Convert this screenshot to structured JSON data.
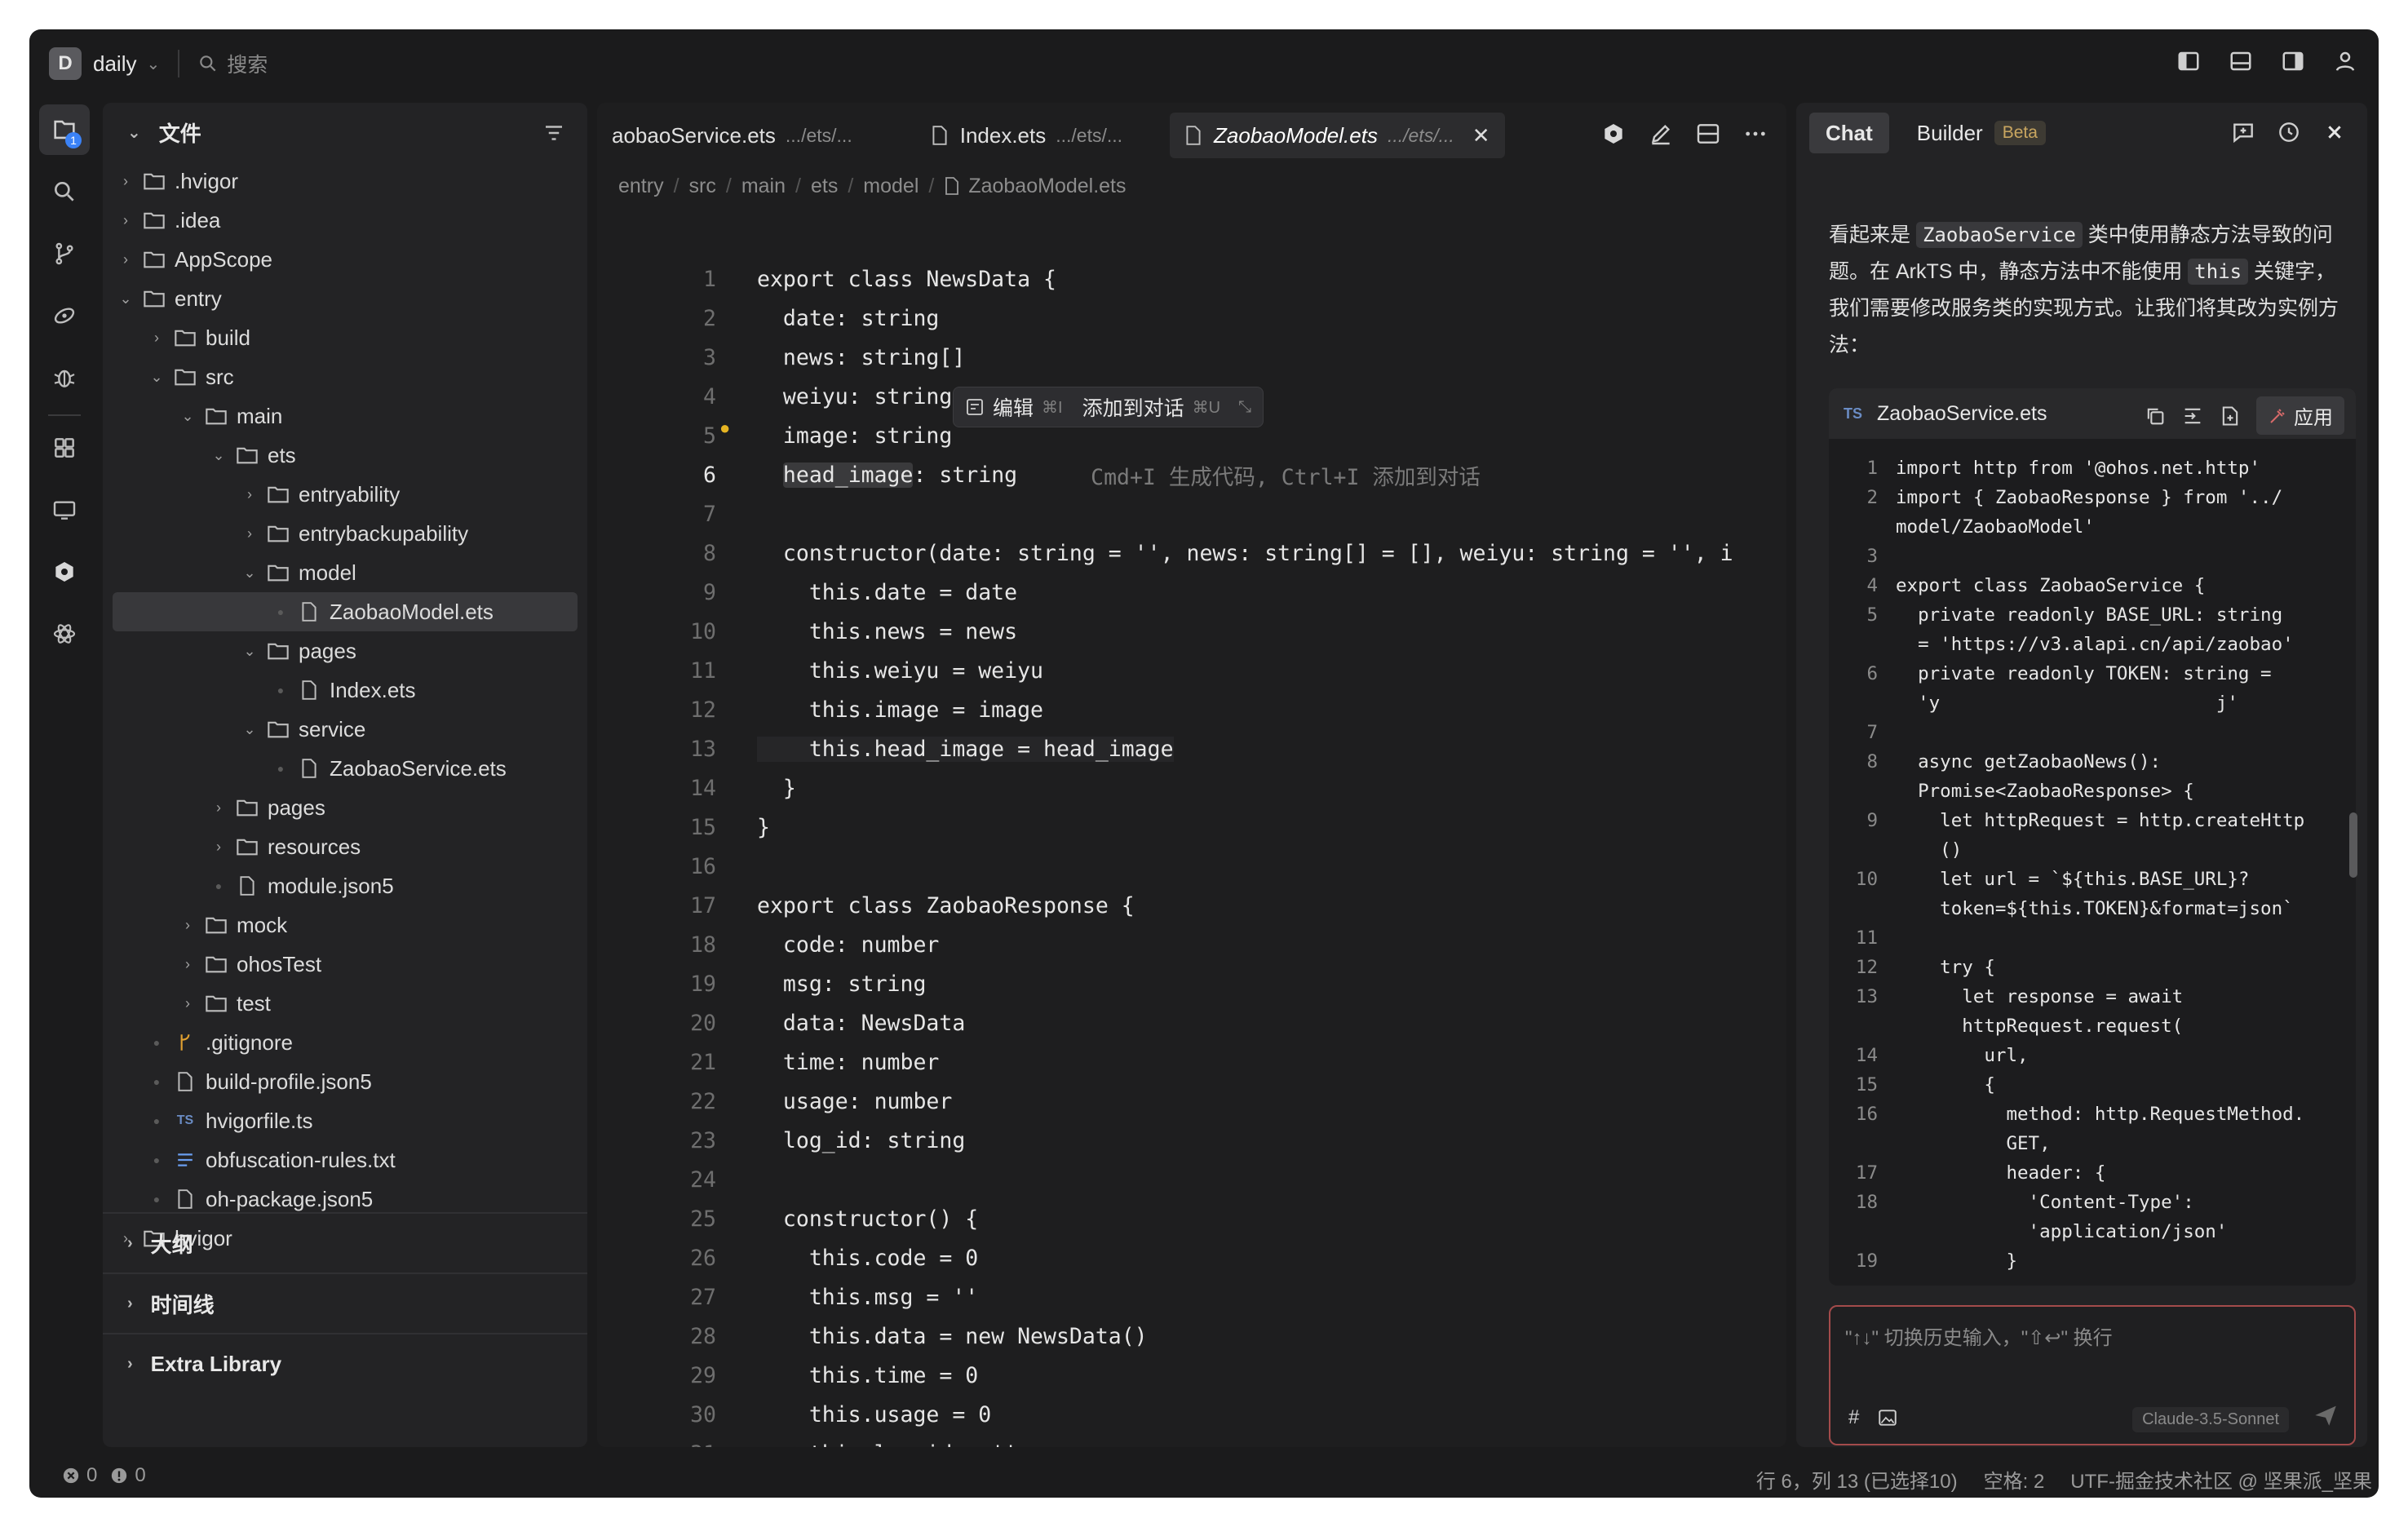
{
  "titlebar": {
    "workspace_initial": "D",
    "workspace_name": "daily",
    "search_placeholder": "搜索"
  },
  "activity": {
    "explorer_badge": "1"
  },
  "explorer": {
    "title": "文件",
    "tree": [
      {
        "label": ".hvigor",
        "kind": "folder",
        "depth": 0,
        "state": "collapsed"
      },
      {
        "label": ".idea",
        "kind": "folder",
        "depth": 0,
        "state": "collapsed"
      },
      {
        "label": "AppScope",
        "kind": "folder",
        "depth": 0,
        "state": "collapsed"
      },
      {
        "label": "entry",
        "kind": "folder",
        "depth": 0,
        "state": "expanded"
      },
      {
        "label": "build",
        "kind": "folder",
        "depth": 1,
        "state": "collapsed"
      },
      {
        "label": "src",
        "kind": "folder",
        "depth": 1,
        "state": "expanded"
      },
      {
        "label": "main",
        "kind": "folder",
        "depth": 2,
        "state": "expanded"
      },
      {
        "label": "ets",
        "kind": "folder",
        "depth": 3,
        "state": "expanded"
      },
      {
        "label": "entryability",
        "kind": "folder",
        "depth": 4,
        "state": "collapsed"
      },
      {
        "label": "entrybackupability",
        "kind": "folder",
        "depth": 4,
        "state": "collapsed"
      },
      {
        "label": "model",
        "kind": "folder",
        "depth": 4,
        "state": "expanded"
      },
      {
        "label": "ZaobaoModel.ets",
        "kind": "file",
        "depth": 5,
        "state": "selected"
      },
      {
        "label": "pages",
        "kind": "folder",
        "depth": 4,
        "state": "expanded"
      },
      {
        "label": "Index.ets",
        "kind": "file",
        "depth": 5,
        "state": "file"
      },
      {
        "label": "service",
        "kind": "folder",
        "depth": 4,
        "state": "expanded"
      },
      {
        "label": "ZaobaoService.ets",
        "kind": "file",
        "depth": 5,
        "state": "file"
      },
      {
        "label": "pages",
        "kind": "folder",
        "depth": 3,
        "state": "collapsed"
      },
      {
        "label": "resources",
        "kind": "folder",
        "depth": 3,
        "state": "collapsed"
      },
      {
        "label": "module.json5",
        "kind": "file",
        "depth": 3,
        "state": "file"
      },
      {
        "label": "mock",
        "kind": "folder",
        "depth": 2,
        "state": "collapsed"
      },
      {
        "label": "ohosTest",
        "kind": "folder",
        "depth": 2,
        "state": "collapsed"
      },
      {
        "label": "test",
        "kind": "folder",
        "depth": 2,
        "state": "collapsed"
      },
      {
        "label": ".gitignore",
        "kind": "git",
        "depth": 1,
        "state": "file"
      },
      {
        "label": "build-profile.json5",
        "kind": "file",
        "depth": 1,
        "state": "file"
      },
      {
        "label": "hvigorfile.ts",
        "kind": "ts",
        "depth": 1,
        "state": "file"
      },
      {
        "label": "obfuscation-rules.txt",
        "kind": "txt",
        "depth": 1,
        "state": "file"
      },
      {
        "label": "oh-package.json5",
        "kind": "file",
        "depth": 1,
        "state": "file"
      },
      {
        "label": "hvigor",
        "kind": "folder",
        "depth": 0,
        "state": "collapsed"
      }
    ],
    "sections": [
      "大纲",
      "时间线",
      "Extra Library"
    ]
  },
  "editor": {
    "tabs": [
      {
        "name": "aobaoService.ets",
        "path": ".../ets/...",
        "active": false
      },
      {
        "name": "Index.ets",
        "path": ".../ets/...",
        "active": false
      },
      {
        "name": "ZaobaoModel.ets",
        "path": ".../ets/...",
        "active": true
      }
    ],
    "breadcrumb": [
      "entry",
      "src",
      "main",
      "ets",
      "model",
      "ZaobaoModel.ets"
    ],
    "inline_popup": {
      "edit": "编辑",
      "edit_key": "⌘I",
      "add": "添加到对话",
      "add_key": "⌘U"
    },
    "ghost_hint": "Cmd+I 生成代码, Ctrl+I 添加到对话",
    "current_line": "6",
    "lines": [
      "export class NewsData {",
      "  date: string",
      "  news: string[]",
      "  weiyu: string",
      "  image: string",
      "  head_image: string",
      "",
      "  constructor(date: string = '', news: string[] = [], weiyu: string = '', i",
      "    this.date = date",
      "    this.news = news",
      "    this.weiyu = weiyu",
      "    this.image = image",
      "    this.head_image = head_image",
      "  }",
      "}",
      "",
      "export class ZaobaoResponse {",
      "  code: number",
      "  msg: string",
      "  data: NewsData",
      "  time: number",
      "  usage: number",
      "  log_id: string",
      "",
      "  constructor() {",
      "    this.code = 0",
      "    this.msg = ''",
      "    this.data = new NewsData()",
      "    this.time = 0",
      "    this.usage = 0",
      "    this.log_id = ''"
    ]
  },
  "chat": {
    "tab_chat": "Chat",
    "tab_builder": "Builder",
    "beta": "Beta",
    "message_parts": [
      "看起来是 ",
      "ZaobaoService",
      " 类中使用静态方法导致的问题。在 ArkTS 中，静态方法中不能使用 ",
      "this",
      " 关键字，我们需要修改服务类的实现方式。让我们将其改为实例方法："
    ],
    "code_file": "ZaobaoService.ets",
    "code_lang": "TS",
    "apply_label": "应用",
    "code_lines": [
      {
        "n": "1",
        "t": "import http from '@ohos.net.http'"
      },
      {
        "n": "2",
        "t": "import { ZaobaoResponse } from '../"
      },
      {
        "n": "",
        "t": "model/ZaobaoModel'"
      },
      {
        "n": "3",
        "t": ""
      },
      {
        "n": "4",
        "t": "export class ZaobaoService {"
      },
      {
        "n": "5",
        "t": "  private readonly BASE_URL: string"
      },
      {
        "n": "",
        "t": "  = 'https://v3.alapi.cn/api/zaobao'"
      },
      {
        "n": "6",
        "t": "  private readonly TOKEN: string ="
      },
      {
        "n": "",
        "t": "  'y                         j'"
      },
      {
        "n": "7",
        "t": ""
      },
      {
        "n": "8",
        "t": "  async getZaobaoNews():"
      },
      {
        "n": "",
        "t": "  Promise<ZaobaoResponse> {"
      },
      {
        "n": "9",
        "t": "    let httpRequest = http.createHttp"
      },
      {
        "n": "",
        "t": "    ()"
      },
      {
        "n": "10",
        "t": "    let url = `${this.BASE_URL}?"
      },
      {
        "n": "",
        "t": "    token=${this.TOKEN}&format=json`"
      },
      {
        "n": "11",
        "t": ""
      },
      {
        "n": "12",
        "t": "    try {"
      },
      {
        "n": "13",
        "t": "      let response = await"
      },
      {
        "n": "",
        "t": "      httpRequest.request("
      },
      {
        "n": "14",
        "t": "        url,"
      },
      {
        "n": "15",
        "t": "        {"
      },
      {
        "n": "16",
        "t": "          method: http.RequestMethod."
      },
      {
        "n": "",
        "t": "          GET,"
      },
      {
        "n": "17",
        "t": "          header: {"
      },
      {
        "n": "18",
        "t": "            'Content-Type':"
      },
      {
        "n": "",
        "t": "            'application/json'"
      },
      {
        "n": "19",
        "t": "          }"
      }
    ],
    "input_placeholder": "\"↑↓\" 切换历史输入，\"⇧↩\" 换行",
    "model": "Claude-3.5-Sonnet"
  },
  "status": {
    "errors": "0",
    "warnings": "0",
    "position": "行 6，列 13 (已选择10)",
    "spaces": "空格: 2",
    "encoding": "UTF-掘金技术社区 @ 坚果派_坚果"
  }
}
